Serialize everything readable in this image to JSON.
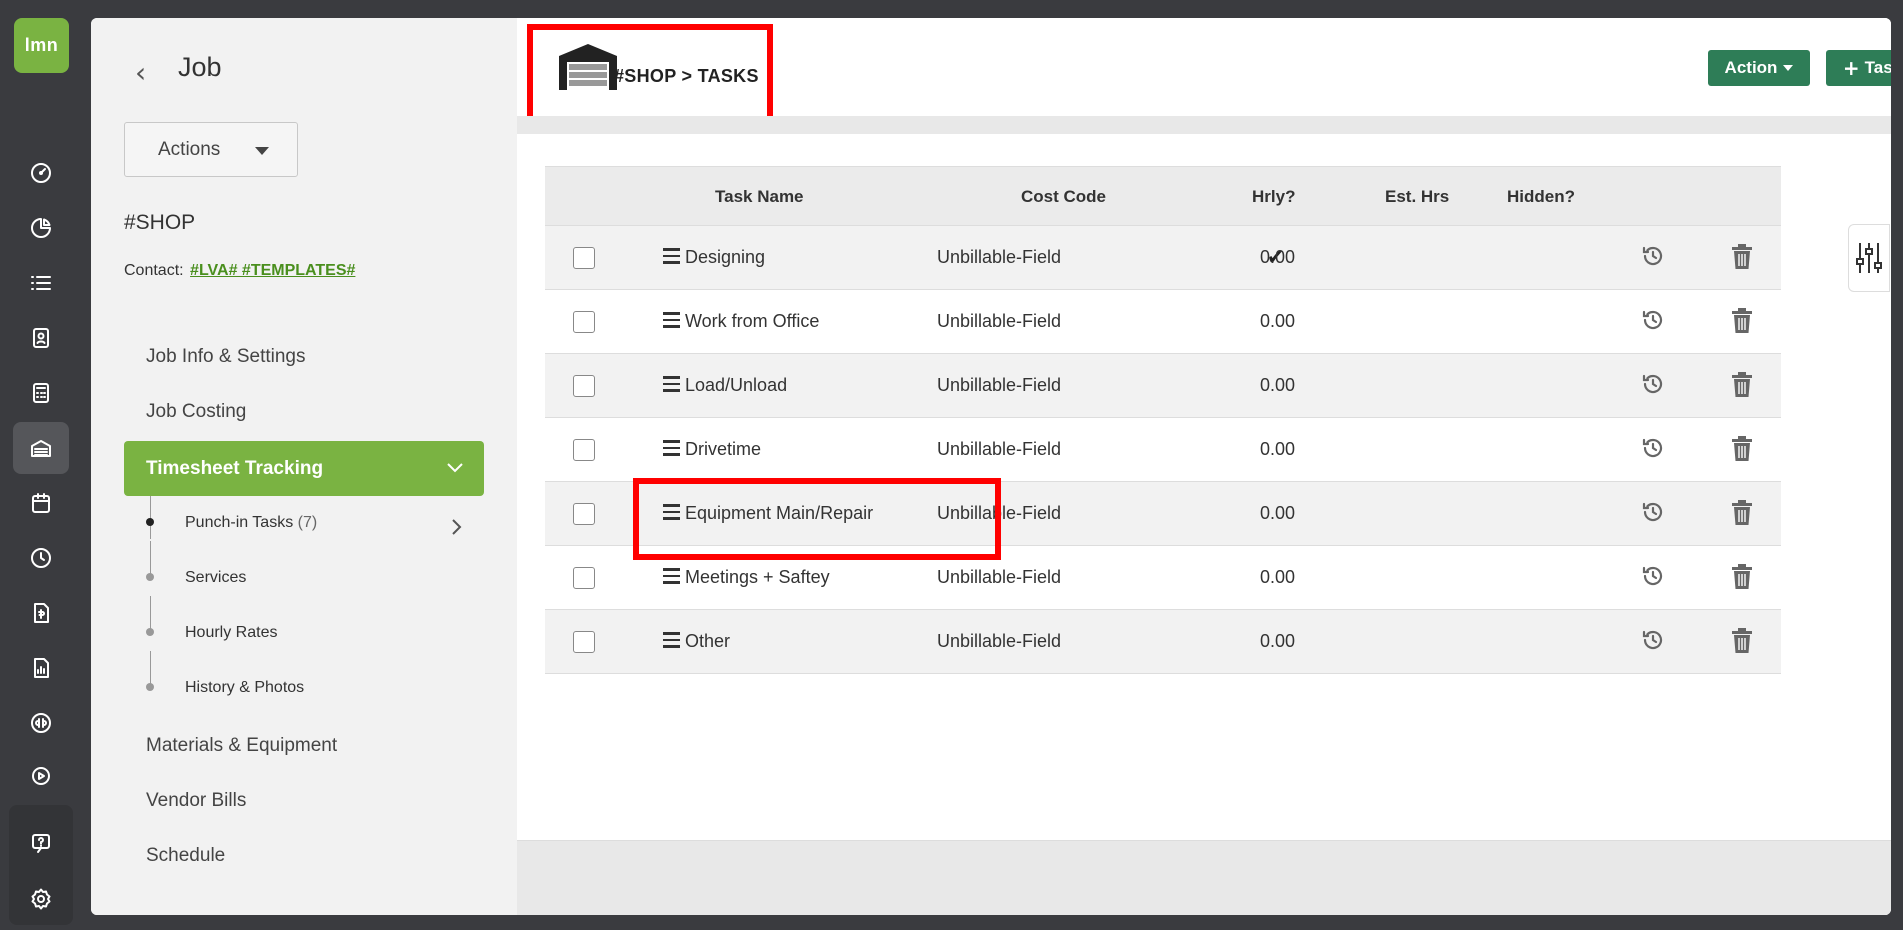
{
  "app": {
    "logo_text": "lmn"
  },
  "rail": {
    "icons": [
      "dashboard-icon",
      "pie-chart-icon",
      "list-icon",
      "contact-card-icon",
      "calculator-icon",
      "garage-icon",
      "calendar-icon",
      "clock-icon",
      "invoice-icon",
      "report-icon",
      "quickbooks-icon",
      "play-icon",
      "help-icon",
      "settings-icon"
    ],
    "active": "garage-icon"
  },
  "job_panel": {
    "title": "Job",
    "actions_label": "Actions",
    "job_name": "#SHOP",
    "contact_label": "Contact:",
    "contact_value": "#LVA# #TEMPLATES#",
    "nav": [
      {
        "label": "Job Info & Settings"
      },
      {
        "label": "Job Costing"
      },
      {
        "label": "Timesheet Tracking"
      },
      {
        "label": "Materials & Equipment"
      },
      {
        "label": "Vendor Bills"
      },
      {
        "label": "Schedule"
      }
    ],
    "sub_nav": [
      {
        "label": "Punch-in Tasks",
        "count": "(7)"
      },
      {
        "label": "Services"
      },
      {
        "label": "Hourly Rates"
      },
      {
        "label": "History & Photos"
      }
    ]
  },
  "header": {
    "breadcrumb": "#SHOP > TASKS",
    "action_label": "Action",
    "task_label": "Task"
  },
  "table": {
    "columns": [
      "Task Name",
      "Cost Code",
      "Hrly?",
      "Est. Hrs",
      "Hidden?"
    ],
    "rows": [
      {
        "name": "Designing",
        "cost_code": "Unbillable-Field",
        "hourly": true,
        "est_hrs": "0.00"
      },
      {
        "name": "Work from Office",
        "cost_code": "Unbillable-Field",
        "hourly": false,
        "est_hrs": "0.00"
      },
      {
        "name": "Load/Unload",
        "cost_code": "Unbillable-Field",
        "hourly": false,
        "est_hrs": "0.00"
      },
      {
        "name": "Drivetime",
        "cost_code": "Unbillable-Field",
        "hourly": false,
        "est_hrs": "0.00"
      },
      {
        "name": "Equipment Main/Repair",
        "cost_code": "Unbillable-Field",
        "hourly": false,
        "est_hrs": "0.00"
      },
      {
        "name": "Meetings + Saftey",
        "cost_code": "Unbillable-Field",
        "hourly": false,
        "est_hrs": "0.00"
      },
      {
        "name": "Other",
        "cost_code": "Unbillable-Field",
        "hourly": false,
        "est_hrs": "0.00"
      }
    ]
  },
  "colors": {
    "brand_green": "#7ab342",
    "button_green": "#2e7d57",
    "highlight_red": "#ff0000",
    "rail_bg": "#3a3b3f"
  }
}
